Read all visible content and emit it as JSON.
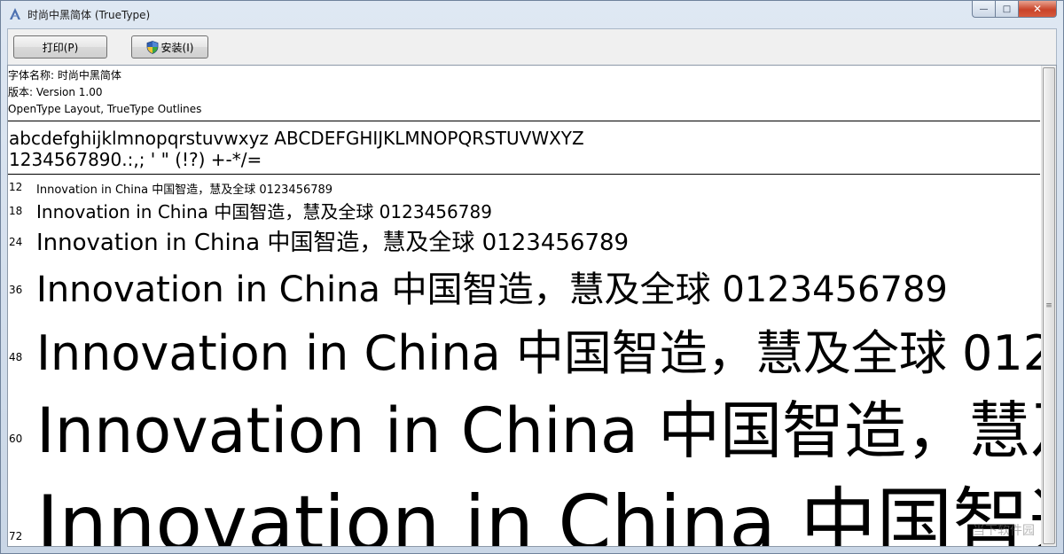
{
  "window": {
    "title": "时尚中黑简体 (TrueType)",
    "controls": {
      "minimize": "—",
      "maximize": "□",
      "close": "✕"
    }
  },
  "toolbar": {
    "print_label": "打印(P)",
    "install_label": "安装(I)"
  },
  "font_info": {
    "name_line": "字体名称: 时尚中黑简体",
    "version_line": "版本: Version  1.00",
    "type_line": "OpenType Layout, TrueType Outlines"
  },
  "charset": {
    "line1": "abcdefghijklmnopqrstuvwxyz ABCDEFGHIJKLMNOPQRSTUVWXYZ",
    "line2": "1234567890.:,; ' \" (!?) +-*/="
  },
  "samples": {
    "text": "Innovation in China 中国智造，慧及全球 0123456789",
    "rows": [
      {
        "size": "12"
      },
      {
        "size": "18"
      },
      {
        "size": "24"
      },
      {
        "size": "36"
      },
      {
        "size": "48"
      },
      {
        "size": "60"
      },
      {
        "size": "72"
      }
    ]
  },
  "watermark": "当下软件园"
}
